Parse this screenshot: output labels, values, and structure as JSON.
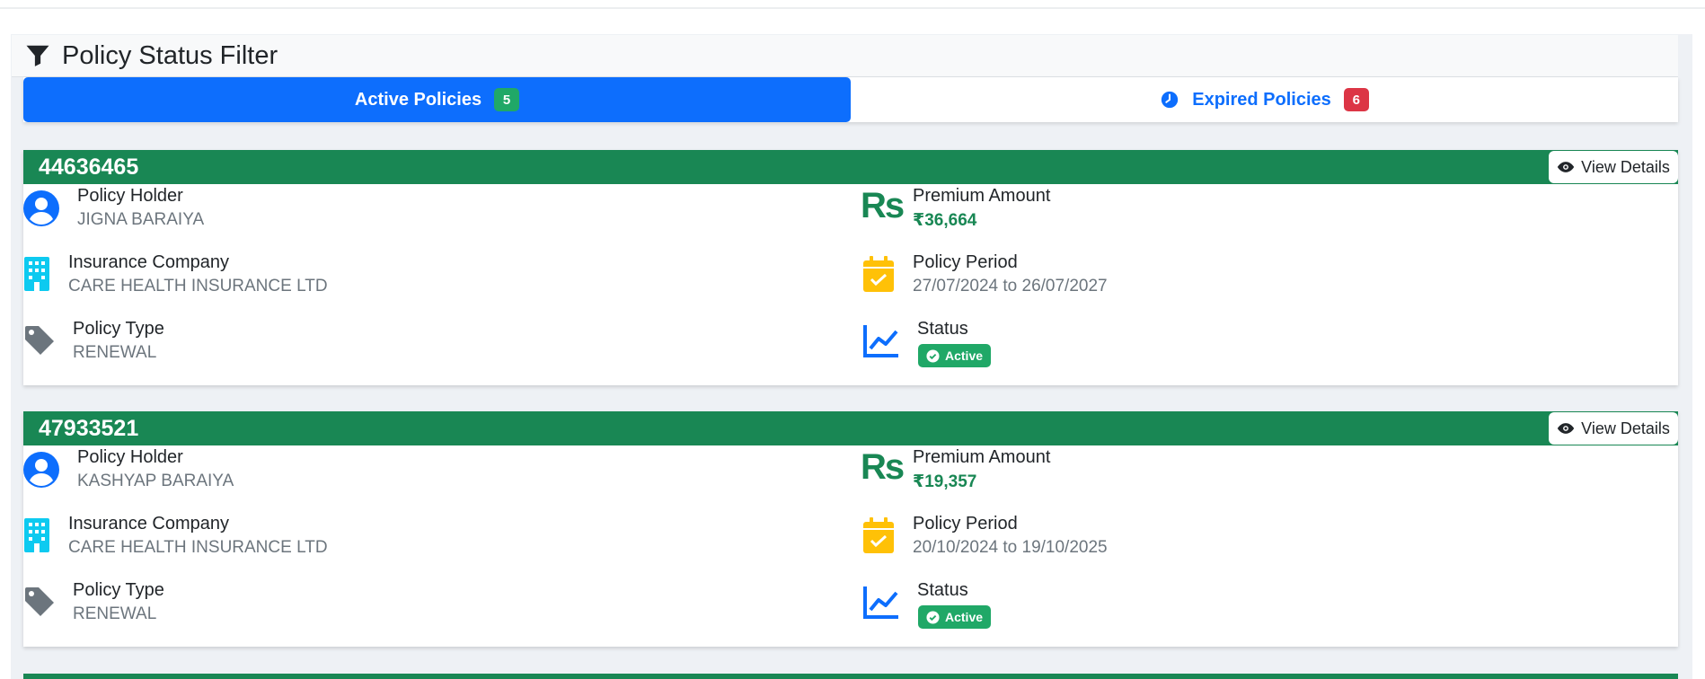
{
  "filter": {
    "title": "Policy Status Filter",
    "icon": "filter-icon"
  },
  "tabs": [
    {
      "label": "Active Policies",
      "count": "5",
      "active": true
    },
    {
      "label": "Expired Policies",
      "count": "6",
      "active": false,
      "icon": "clock-icon"
    }
  ],
  "labels": {
    "holder": "Policy Holder",
    "company": "Insurance Company",
    "type": "Policy Type",
    "premium": "Premium Amount",
    "period": "Policy Period",
    "status": "Status",
    "view_details": "View Details"
  },
  "policies": [
    {
      "number": "44636465",
      "holder": "JIGNA BARAIYA",
      "company": "CARE HEALTH INSURANCE LTD",
      "type": "RENEWAL",
      "premium": "₹36,664",
      "period": "27/07/2024 to 26/07/2027",
      "status": "Active"
    },
    {
      "number": "47933521",
      "holder": "KASHYAP BARAIYA",
      "company": "CARE HEALTH INSURANCE LTD",
      "type": "RENEWAL",
      "premium": "₹19,357",
      "period": "20/10/2024 to 19/10/2025",
      "status": "Active"
    }
  ],
  "colors": {
    "primary": "#0d6efd",
    "success": "#198754",
    "danger": "#dc3545",
    "warning": "#ffc107",
    "info": "#0dcaf0"
  }
}
